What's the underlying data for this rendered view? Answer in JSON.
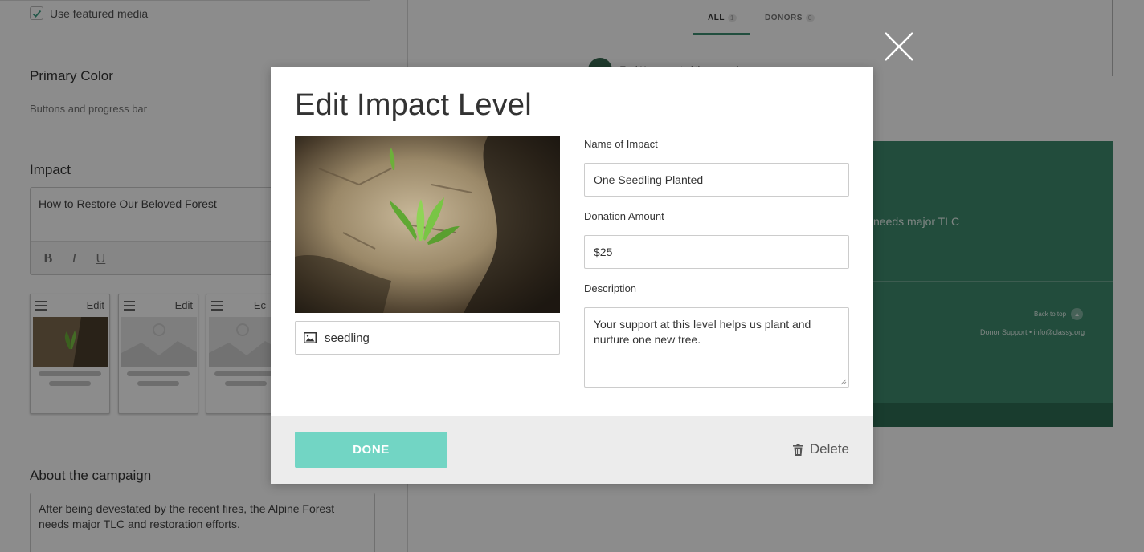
{
  "background": {
    "featured_media_label": "Use featured media",
    "featured_media_checked": true,
    "primary_color_title": "Primary Color",
    "primary_color_sub": "Buttons and progress bar",
    "impact_title": "Impact",
    "impact_editor_text": "How to Restore Our Beloved Forest",
    "editor_buttons": [
      "B",
      "I",
      "U"
    ],
    "impact_cards": [
      {
        "edit_label": "Edit",
        "image": "seedling-photo"
      },
      {
        "edit_label": "Edit",
        "image": "placeholder-image"
      },
      {
        "edit_label": "Ec",
        "image": "placeholder-image"
      }
    ],
    "about_title": "About the campaign",
    "about_text": "After being devestated by the recent fires, the Alpine Forest needs major TLC and restoration efforts.",
    "tabs": [
      {
        "label": "ALL",
        "count": "1"
      },
      {
        "label": "DONORS",
        "count": "0"
      }
    ],
    "activity_text": "Terri Harel created the campaign",
    "preview_text": "needs major TLC",
    "back_to_top": "Back to top",
    "donor_support": "Donor Support • info@classy.org"
  },
  "modal": {
    "title": "Edit Impact Level",
    "image_name": "seedling",
    "name_label": "Name of Impact",
    "name_value": "One Seedling Planted",
    "amount_label": "Donation Amount",
    "amount_value": "$25",
    "description_label": "Description",
    "description_value": "Your support at this level helps us plant and nurture one new tree.",
    "done_label": "DONE",
    "delete_label": "Delete"
  },
  "colors": {
    "accent_button": "#72d5c4",
    "preview_green": "#3f8b6e",
    "overlay": "rgba(0,0,0,0.45)"
  },
  "icons": [
    "close-icon",
    "image-icon",
    "trash-icon",
    "check-icon",
    "hamburger-icon",
    "chevron-up-icon"
  ]
}
